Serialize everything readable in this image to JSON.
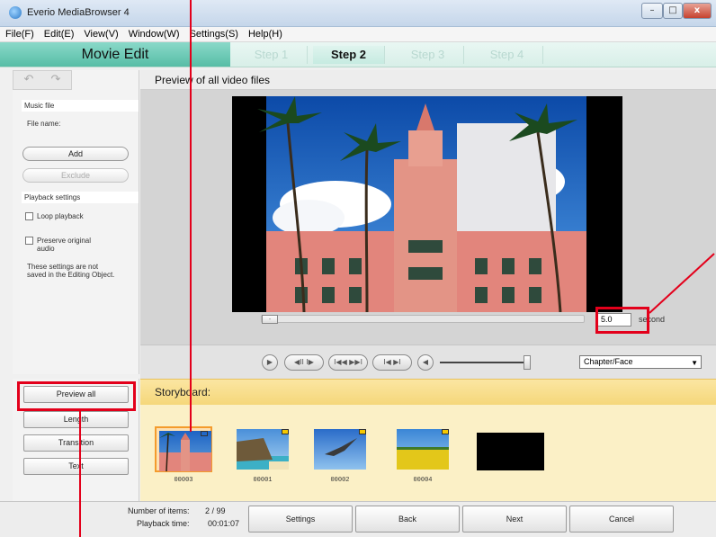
{
  "window": {
    "title": "Everio MediaBrowser 4",
    "btn_min": "–",
    "btn_max": "□",
    "btn_close": "x"
  },
  "menu": [
    "File(F)",
    "Edit(E)",
    "View(V)",
    "Window(W)",
    "Settings(S)",
    "Help(H)"
  ],
  "stepbar": {
    "mode": "Movie Edit",
    "steps": [
      "Step 1",
      "Step 2",
      "Step 3",
      "Step 4"
    ],
    "active_step": "Step 2"
  },
  "left_panel": {
    "undo_icon": "undo-icon",
    "redo_icon": "redo-icon",
    "music_section": "Music file",
    "file_name_label": "File name:",
    "add_label": "Add",
    "exclude_label": "Exclude",
    "playback_section": "Playback settings",
    "loop_label": "Loop playback",
    "preserve_label": "Preserve original audio",
    "note": "These settings are not saved in the Editing Object."
  },
  "preview": {
    "header": "Preview of all video files",
    "slider_knob": "-",
    "seconds_value": "5.0",
    "seconds_unit": "second",
    "chapter_select": "Chapter/Face"
  },
  "left_buttons": [
    "Preview all",
    "Length",
    "Transition",
    "Text"
  ],
  "storyboard": {
    "header": "Storyboard:",
    "clips": [
      {
        "id": "00003",
        "selected": true
      },
      {
        "id": "00001",
        "selected": false
      },
      {
        "id": "00002",
        "selected": false
      },
      {
        "id": "00004",
        "selected": false
      }
    ]
  },
  "status": {
    "items_label": "Number of items:",
    "items_value": "2 / 99",
    "time_label": "Playback time:",
    "time_value": "00:01:07"
  },
  "bottom_buttons": [
    "Settings",
    "Back",
    "Next",
    "Cancel"
  ],
  "colors": {
    "accent": "#57bda6",
    "storyboard": "#fbf0c6",
    "highlight": "#e3001b"
  }
}
